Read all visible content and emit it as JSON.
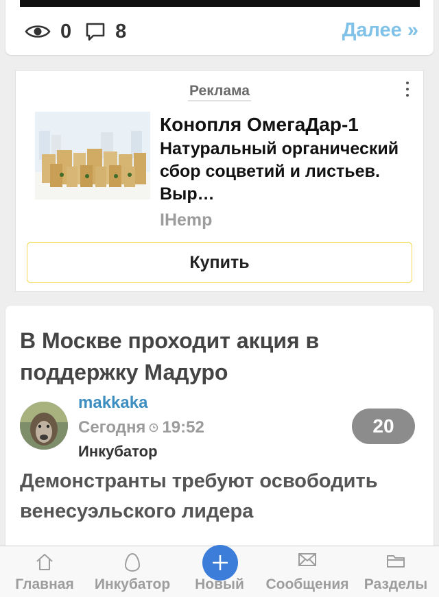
{
  "top_post": {
    "views": "0",
    "comments": "8",
    "more_label": "Далее »"
  },
  "ad": {
    "label": "Реклама",
    "title": "Конопля ОмегаДар-1",
    "description": "Натуральный органический сбор соцветий и листьев. Выр…",
    "source": "IHemp",
    "button_label": "Купить"
  },
  "post": {
    "title": "В Москве проходит акция в поддержку Мадуро",
    "author": "makkaka",
    "date": "Сегодня",
    "time": "19:52",
    "community": "Инкубатор",
    "rating": "20",
    "text": "Демонстранты требуют освободить венесуэльского лидера"
  },
  "bottom_nav": {
    "items": [
      {
        "label": "Главная",
        "icon": "home-icon"
      },
      {
        "label": "Инкубатор",
        "icon": "egg-icon"
      },
      {
        "label": "Новый",
        "icon": "plus-icon"
      },
      {
        "label": "Сообщения",
        "icon": "envelope-icon"
      },
      {
        "label": "Разделы",
        "icon": "folder-icon"
      }
    ]
  },
  "colors": {
    "link": "#3c8fc0",
    "more_link": "#7fc1e7",
    "new_button": "#3b7dd8",
    "buy_border": "#f2d84a",
    "rating_bg": "#8c8c8c"
  }
}
